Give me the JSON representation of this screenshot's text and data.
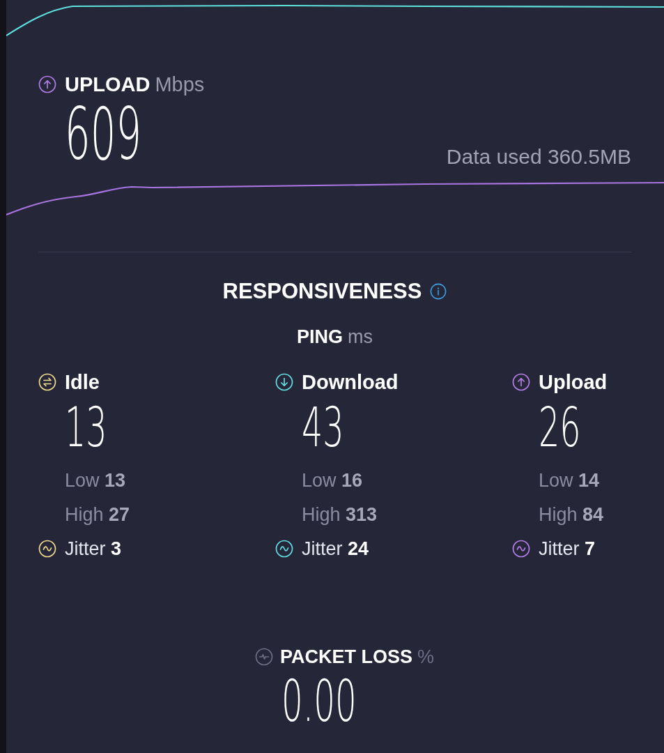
{
  "upload_result": {
    "label": "UPLOAD",
    "unit": "Mbps",
    "value": "609",
    "data_used": "Data used 360.5MB"
  },
  "responsiveness": {
    "title": "RESPONSIVENESS",
    "ping_label": "PING",
    "ping_unit": "ms",
    "columns": [
      {
        "kind": "idle",
        "label": "Idle",
        "color": "#efdc8c",
        "value": "13",
        "low": "Low **13**",
        "high": "High **27**",
        "jitter": "Jitter **3**"
      },
      {
        "kind": "download",
        "label": "Download",
        "color": "#62dfe0",
        "value": "43",
        "low": "Low **16**",
        "high": "High **313**",
        "jitter": "Jitter **24**"
      },
      {
        "kind": "upload",
        "label": "Upload",
        "color": "#b57fe8",
        "value": "26",
        "low": "Low **14**",
        "high": "High **84**",
        "jitter": "Jitter **7**"
      }
    ]
  },
  "packet_loss": {
    "label": "PACKET LOSS",
    "unit": "%",
    "value": "0.00"
  }
}
